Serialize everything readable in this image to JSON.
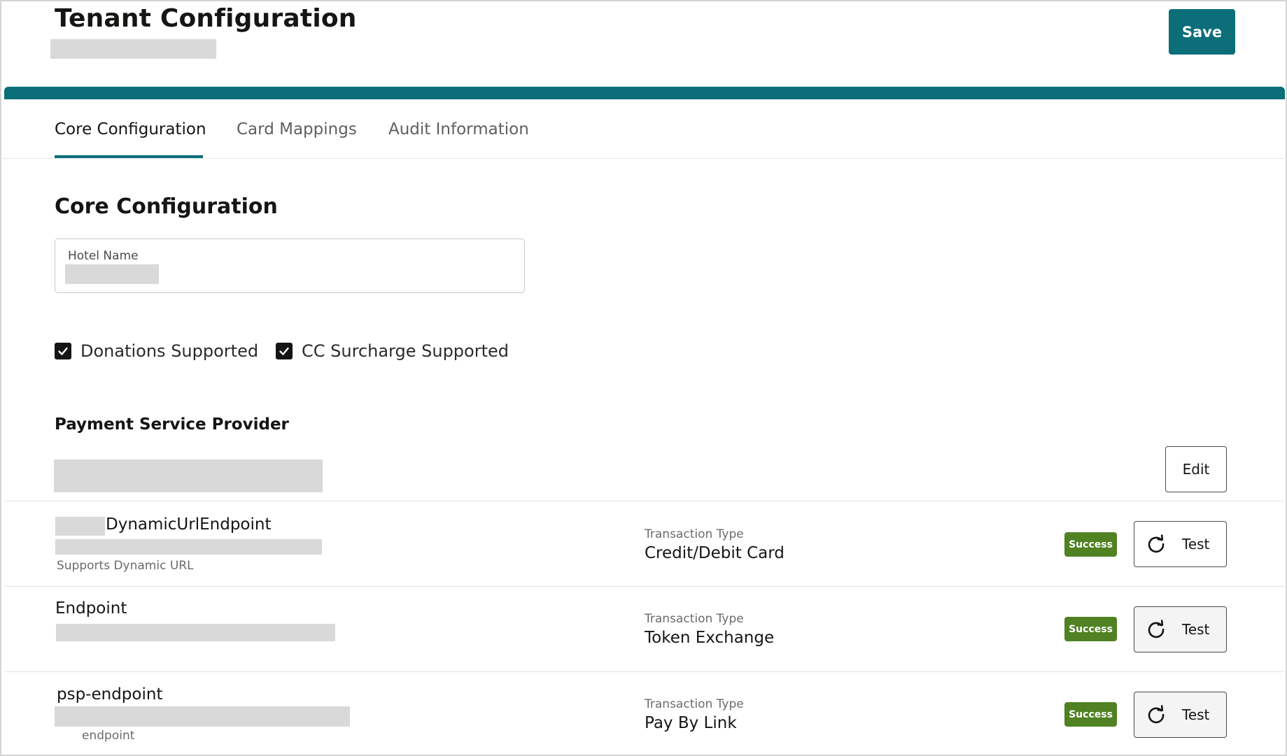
{
  "header": {
    "title": "Tenant Configuration",
    "save_label": "Save"
  },
  "tabs": [
    {
      "label": "Core Configuration",
      "active": true
    },
    {
      "label": "Card Mappings",
      "active": false
    },
    {
      "label": "Audit Information",
      "active": false
    }
  ],
  "core": {
    "section_title": "Core Configuration",
    "hotel_name_label": "Hotel Name",
    "checkboxes": [
      {
        "label": "Donations Supported",
        "checked": true
      },
      {
        "label": "CC Surcharge Supported",
        "checked": true
      }
    ]
  },
  "psp": {
    "title": "Payment Service Provider",
    "edit_label": "Edit",
    "endpoints": [
      {
        "name": "DynamicUrlEndpoint",
        "sub": "Supports Dynamic URL",
        "tx_label": "Transaction Type",
        "tx_value": "Credit/Debit Card",
        "status": "Success",
        "test_label": "Test"
      },
      {
        "name": "Endpoint",
        "sub": "",
        "tx_label": "Transaction Type",
        "tx_value": "Token Exchange",
        "status": "Success",
        "test_label": "Test"
      },
      {
        "name": "psp-endpoint",
        "sub": "endpoint",
        "tx_label": "Transaction Type",
        "tx_value": "Pay By Link",
        "status": "Success",
        "test_label": "Test"
      }
    ]
  },
  "colors": {
    "accent": "#0b6e78",
    "success": "#508223"
  },
  "icons": {
    "checkbox": "checkmark-icon",
    "test": "refresh-icon"
  }
}
